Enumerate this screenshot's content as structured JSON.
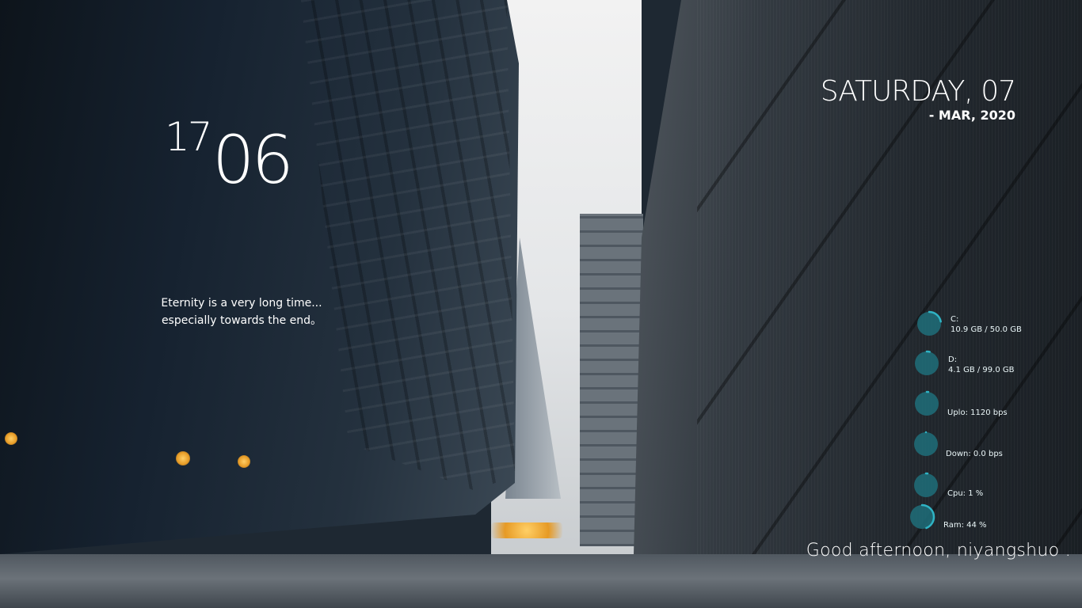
{
  "clock": {
    "hour": "17",
    "minute": "06"
  },
  "quote": {
    "line1": "Eternity is a very long time...",
    "line2": "especially towards the end。"
  },
  "date": {
    "day_line": "SATURDAY, 07",
    "month_line": "- MAR, 2020"
  },
  "system": {
    "gauge_color": "#2fb3c4",
    "gauge_track_color": "#1f6f7a",
    "items": [
      {
        "id": "drive-c",
        "label": "C:",
        "value": "10.9 GB / 50.0 GB",
        "percent": 22
      },
      {
        "id": "drive-d",
        "label": "D:",
        "value": "4.1 GB / 99.0 GB",
        "percent": 4
      },
      {
        "id": "upload",
        "label": "",
        "value": "Uplo: 1120 bps",
        "percent": 1
      },
      {
        "id": "download",
        "label": "",
        "value": "Down: 0.0 bps",
        "percent": 0
      },
      {
        "id": "cpu",
        "label": "",
        "value": "Cpu: 1 %",
        "percent": 1
      },
      {
        "id": "ram",
        "label": "",
        "value": "Ram: 44 %",
        "percent": 44
      }
    ]
  },
  "greeting": {
    "text": "Good afternoon, niyangshuo ."
  }
}
